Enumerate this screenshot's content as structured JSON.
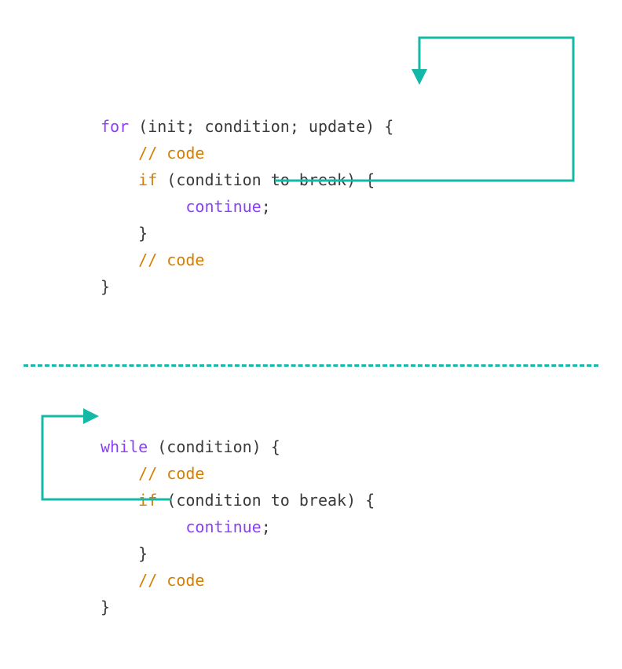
{
  "colors": {
    "keyword_purple": "#8a3ffc",
    "keyword_orange": "#d67e00",
    "text": "#3a3a3a",
    "arrow": "#14b8a6",
    "divider": "#14b8a6"
  },
  "for_block": {
    "line1_for": "for",
    "line1_rest": " (init; condition; update) {",
    "line2_comment": "// code",
    "line3_if": "if",
    "line3_rest": " (condition to break) {",
    "line4_continue": "continue",
    "line4_semi": ";",
    "line5_brace": "}",
    "line6_comment": "// code",
    "line7_brace": "}"
  },
  "while_block": {
    "line1_while": "while",
    "line1_rest": " (condition) {",
    "line2_comment": "// code",
    "line3_if": "if",
    "line3_rest": " (condition to break) {",
    "line4_continue": "continue",
    "line4_semi": ";",
    "line5_brace": "}",
    "line6_comment": "// code",
    "line7_brace": "}"
  },
  "diagram": {
    "arrow1_description": "continue in for-loop jumps to update expression",
    "arrow2_description": "continue in while-loop jumps to while condition"
  }
}
